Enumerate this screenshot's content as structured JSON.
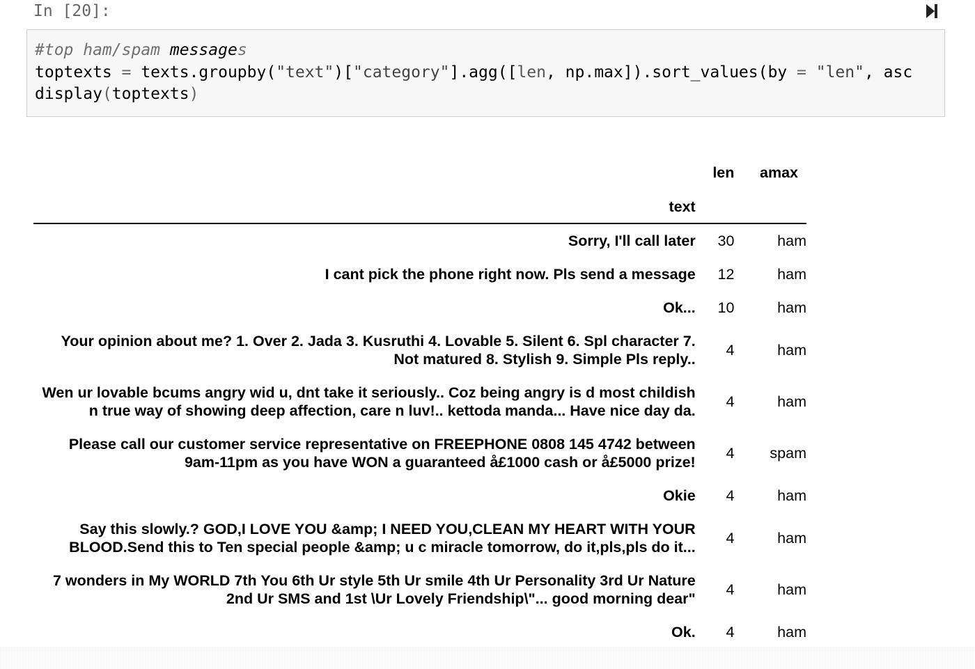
{
  "cell": {
    "prompt": "In [20]:",
    "run_icon": "run-to-end-icon",
    "code_lines": [
      [
        "#top ham/spam messages"
      ],
      [
        "toptexts = texts.groupby(\"text\")[\"category\"].agg([len, np.max]).sort_values(by = \"len\", asc"
      ],
      [
        "display(toptexts)"
      ]
    ]
  },
  "output": {
    "columns": [
      "len",
      "amax"
    ],
    "index_name": "text",
    "rows": [
      {
        "text": "Sorry, I'll call later",
        "len": "30",
        "amax": "ham"
      },
      {
        "text": "I cant pick the phone right now. Pls send a message",
        "len": "12",
        "amax": "ham"
      },
      {
        "text": "Ok...",
        "len": "10",
        "amax": "ham"
      },
      {
        "text": "Your opinion about me? 1. Over 2. Jada 3. Kusruthi 4. Lovable 5. Silent 6. Spl character 7. Not matured 8. Stylish 9. Simple Pls reply..",
        "len": "4",
        "amax": "ham"
      },
      {
        "text": "Wen ur lovable bcums angry wid u, dnt take it seriously.. Coz being angry is d most childish n true way of showing deep affection, care n luv!.. kettoda manda... Have nice day da.",
        "len": "4",
        "amax": "ham"
      },
      {
        "text": "Please call our customer service representative on FREEPHONE 0808 145 4742 between 9am-11pm as you have WON a guaranteed å£1000 cash or å£5000 prize!",
        "len": "4",
        "amax": "spam"
      },
      {
        "text": "Okie",
        "len": "4",
        "amax": "ham"
      },
      {
        "text": "Say this slowly.? GOD,I LOVE YOU &amp; I NEED YOU,CLEAN MY HEART WITH YOUR BLOOD.Send this to Ten special people &amp; u c miracle tomorrow, do it,pls,pls do it...",
        "len": "4",
        "amax": "ham"
      },
      {
        "text": "7 wonders in My WORLD 7th You 6th Ur style 5th Ur smile 4th Ur Personality 3rd Ur Nature 2nd Ur SMS and 1st \\Ur Lovely Friendship\\\"... good morning dear\"",
        "len": "4",
        "amax": "ham"
      },
      {
        "text": "Ok.",
        "len": "4",
        "amax": "ham"
      }
    ]
  }
}
